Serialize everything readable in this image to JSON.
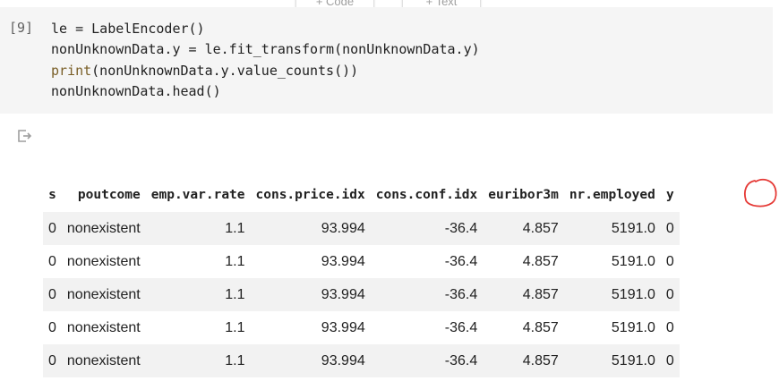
{
  "toolbar": {
    "code_label": "+ Code",
    "text_label": "+ Text"
  },
  "cell": {
    "execution_count": "[9]",
    "code_lines": [
      "le = LabelEncoder()",
      "nonUnknownData.y = le.fit_transform(nonUnknownData.y)",
      "nonUnknownData.head()"
    ],
    "print_keyword": "print",
    "print_rest": "(nonUnknownData.y.value_counts())"
  },
  "table": {
    "columns": [
      "s",
      "poutcome",
      "emp.var.rate",
      "cons.price.idx",
      "cons.conf.idx",
      "euribor3m",
      "nr.employed",
      "y"
    ],
    "rows": [
      [
        "0",
        "nonexistent",
        "1.1",
        "93.994",
        "-36.4",
        "4.857",
        "5191.0",
        "0"
      ],
      [
        "0",
        "nonexistent",
        "1.1",
        "93.994",
        "-36.4",
        "4.857",
        "5191.0",
        "0"
      ],
      [
        "0",
        "nonexistent",
        "1.1",
        "93.994",
        "-36.4",
        "4.857",
        "5191.0",
        "0"
      ],
      [
        "0",
        "nonexistent",
        "1.1",
        "93.994",
        "-36.4",
        "4.857",
        "5191.0",
        "0"
      ],
      [
        "0",
        "nonexistent",
        "1.1",
        "93.994",
        "-36.4",
        "4.857",
        "5191.0",
        "0"
      ]
    ]
  },
  "colors": {
    "annotation": "#e53935",
    "cell_bg": "#f5f5f5",
    "row_stripe": "#f2f2f2"
  }
}
